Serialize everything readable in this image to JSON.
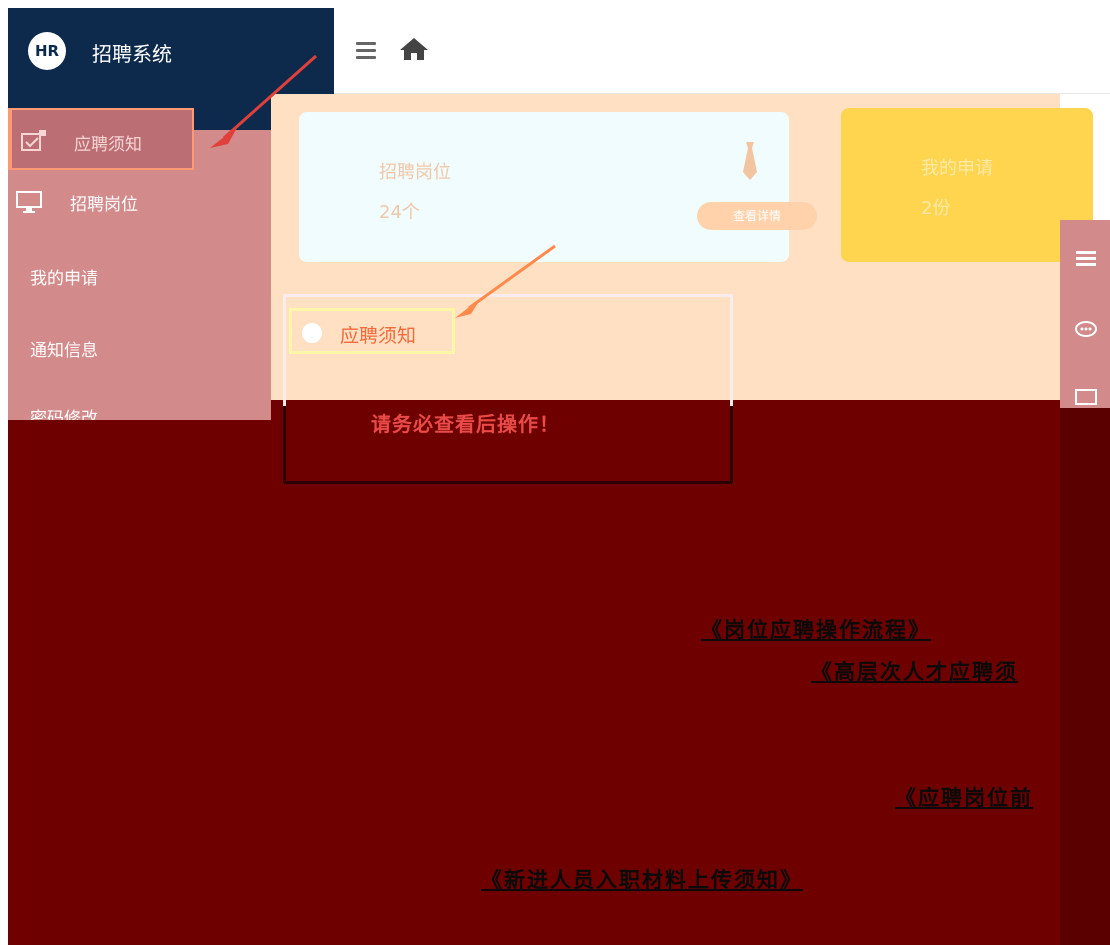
{
  "brand": {
    "logo": "HR",
    "title": "招聘系统"
  },
  "sidebar": {
    "items": [
      {
        "label": "应聘须知",
        "icon": "calendar-check-icon",
        "active": true
      },
      {
        "label": "招聘岗位",
        "icon": "monitor-icon"
      },
      {
        "label": "我的申请"
      },
      {
        "label": "通知信息"
      },
      {
        "label": "密码修改"
      }
    ]
  },
  "header": {
    "menu_icon": "hamburger-icon",
    "home_icon": "home-icon"
  },
  "cards": [
    {
      "label": "招聘岗位",
      "value": "24个",
      "icon": "tie-icon",
      "button": "查看详情"
    },
    {
      "label": "我的申请",
      "value": "2份"
    }
  ],
  "notice": {
    "title": "应聘须知",
    "warning": "请务必查看后操作！",
    "links": [
      "《岗位应聘操作流程》",
      "《高层次人才应聘须",
      "《应聘岗位前",
      "《新进人员入职材料上传须知》"
    ]
  },
  "rightbar": {
    "icons": [
      "list-icon",
      "chat-icon",
      "monitor-icon"
    ]
  },
  "colors": {
    "sidebar_brand": "#0d2a4d",
    "accent": "#ff9a74",
    "card_yellow": "#ffd54f",
    "warning_red": "#e94b48"
  }
}
